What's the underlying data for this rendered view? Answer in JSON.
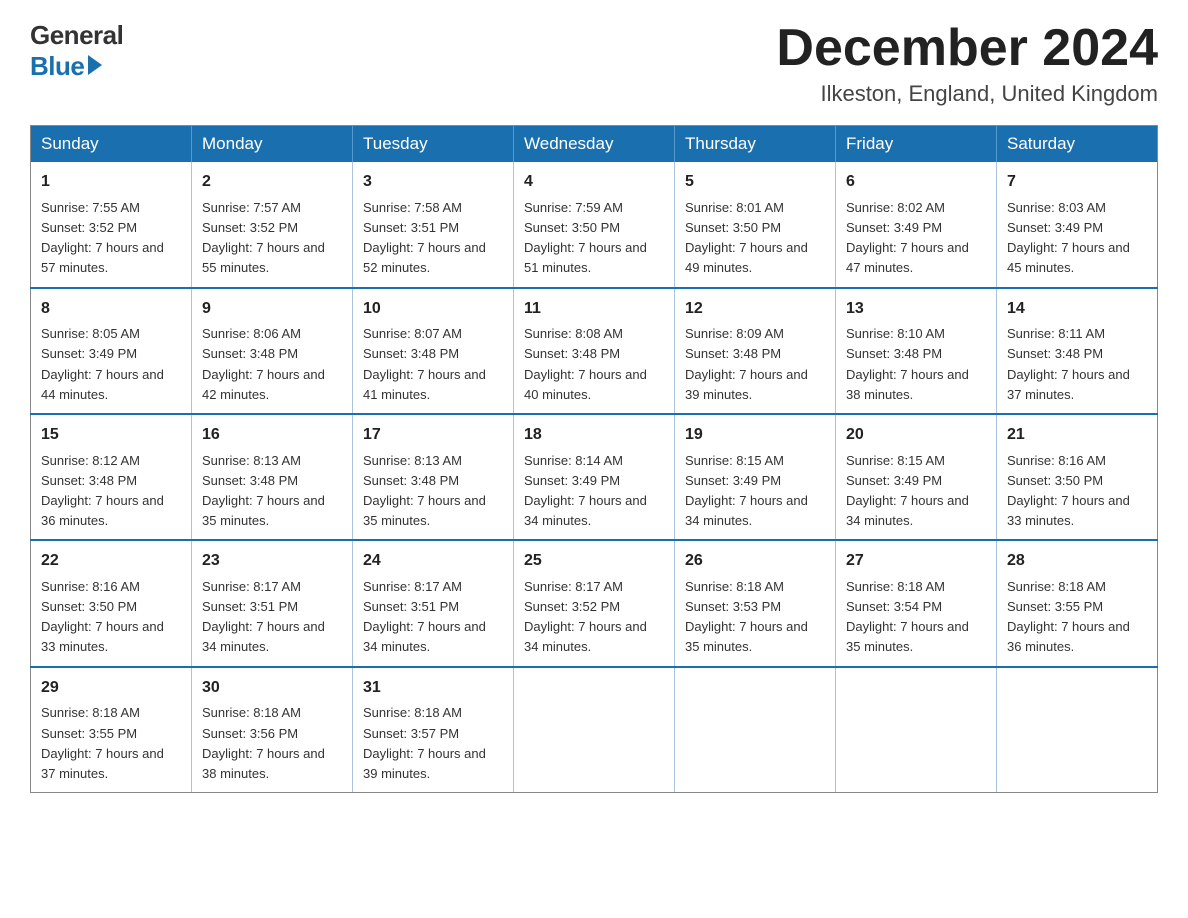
{
  "logo": {
    "general": "General",
    "blue": "Blue"
  },
  "title": "December 2024",
  "location": "Ilkeston, England, United Kingdom",
  "weekdays": [
    "Sunday",
    "Monday",
    "Tuesday",
    "Wednesday",
    "Thursday",
    "Friday",
    "Saturday"
  ],
  "weeks": [
    [
      {
        "day": "1",
        "sunrise": "7:55 AM",
        "sunset": "3:52 PM",
        "daylight": "7 hours and 57 minutes."
      },
      {
        "day": "2",
        "sunrise": "7:57 AM",
        "sunset": "3:52 PM",
        "daylight": "7 hours and 55 minutes."
      },
      {
        "day": "3",
        "sunrise": "7:58 AM",
        "sunset": "3:51 PM",
        "daylight": "7 hours and 52 minutes."
      },
      {
        "day": "4",
        "sunrise": "7:59 AM",
        "sunset": "3:50 PM",
        "daylight": "7 hours and 51 minutes."
      },
      {
        "day": "5",
        "sunrise": "8:01 AM",
        "sunset": "3:50 PM",
        "daylight": "7 hours and 49 minutes."
      },
      {
        "day": "6",
        "sunrise": "8:02 AM",
        "sunset": "3:49 PM",
        "daylight": "7 hours and 47 minutes."
      },
      {
        "day": "7",
        "sunrise": "8:03 AM",
        "sunset": "3:49 PM",
        "daylight": "7 hours and 45 minutes."
      }
    ],
    [
      {
        "day": "8",
        "sunrise": "8:05 AM",
        "sunset": "3:49 PM",
        "daylight": "7 hours and 44 minutes."
      },
      {
        "day": "9",
        "sunrise": "8:06 AM",
        "sunset": "3:48 PM",
        "daylight": "7 hours and 42 minutes."
      },
      {
        "day": "10",
        "sunrise": "8:07 AM",
        "sunset": "3:48 PM",
        "daylight": "7 hours and 41 minutes."
      },
      {
        "day": "11",
        "sunrise": "8:08 AM",
        "sunset": "3:48 PM",
        "daylight": "7 hours and 40 minutes."
      },
      {
        "day": "12",
        "sunrise": "8:09 AM",
        "sunset": "3:48 PM",
        "daylight": "7 hours and 39 minutes."
      },
      {
        "day": "13",
        "sunrise": "8:10 AM",
        "sunset": "3:48 PM",
        "daylight": "7 hours and 38 minutes."
      },
      {
        "day": "14",
        "sunrise": "8:11 AM",
        "sunset": "3:48 PM",
        "daylight": "7 hours and 37 minutes."
      }
    ],
    [
      {
        "day": "15",
        "sunrise": "8:12 AM",
        "sunset": "3:48 PM",
        "daylight": "7 hours and 36 minutes."
      },
      {
        "day": "16",
        "sunrise": "8:13 AM",
        "sunset": "3:48 PM",
        "daylight": "7 hours and 35 minutes."
      },
      {
        "day": "17",
        "sunrise": "8:13 AM",
        "sunset": "3:48 PM",
        "daylight": "7 hours and 35 minutes."
      },
      {
        "day": "18",
        "sunrise": "8:14 AM",
        "sunset": "3:49 PM",
        "daylight": "7 hours and 34 minutes."
      },
      {
        "day": "19",
        "sunrise": "8:15 AM",
        "sunset": "3:49 PM",
        "daylight": "7 hours and 34 minutes."
      },
      {
        "day": "20",
        "sunrise": "8:15 AM",
        "sunset": "3:49 PM",
        "daylight": "7 hours and 34 minutes."
      },
      {
        "day": "21",
        "sunrise": "8:16 AM",
        "sunset": "3:50 PM",
        "daylight": "7 hours and 33 minutes."
      }
    ],
    [
      {
        "day": "22",
        "sunrise": "8:16 AM",
        "sunset": "3:50 PM",
        "daylight": "7 hours and 33 minutes."
      },
      {
        "day": "23",
        "sunrise": "8:17 AM",
        "sunset": "3:51 PM",
        "daylight": "7 hours and 34 minutes."
      },
      {
        "day": "24",
        "sunrise": "8:17 AM",
        "sunset": "3:51 PM",
        "daylight": "7 hours and 34 minutes."
      },
      {
        "day": "25",
        "sunrise": "8:17 AM",
        "sunset": "3:52 PM",
        "daylight": "7 hours and 34 minutes."
      },
      {
        "day": "26",
        "sunrise": "8:18 AM",
        "sunset": "3:53 PM",
        "daylight": "7 hours and 35 minutes."
      },
      {
        "day": "27",
        "sunrise": "8:18 AM",
        "sunset": "3:54 PM",
        "daylight": "7 hours and 35 minutes."
      },
      {
        "day": "28",
        "sunrise": "8:18 AM",
        "sunset": "3:55 PM",
        "daylight": "7 hours and 36 minutes."
      }
    ],
    [
      {
        "day": "29",
        "sunrise": "8:18 AM",
        "sunset": "3:55 PM",
        "daylight": "7 hours and 37 minutes."
      },
      {
        "day": "30",
        "sunrise": "8:18 AM",
        "sunset": "3:56 PM",
        "daylight": "7 hours and 38 minutes."
      },
      {
        "day": "31",
        "sunrise": "8:18 AM",
        "sunset": "3:57 PM",
        "daylight": "7 hours and 39 minutes."
      },
      null,
      null,
      null,
      null
    ]
  ]
}
